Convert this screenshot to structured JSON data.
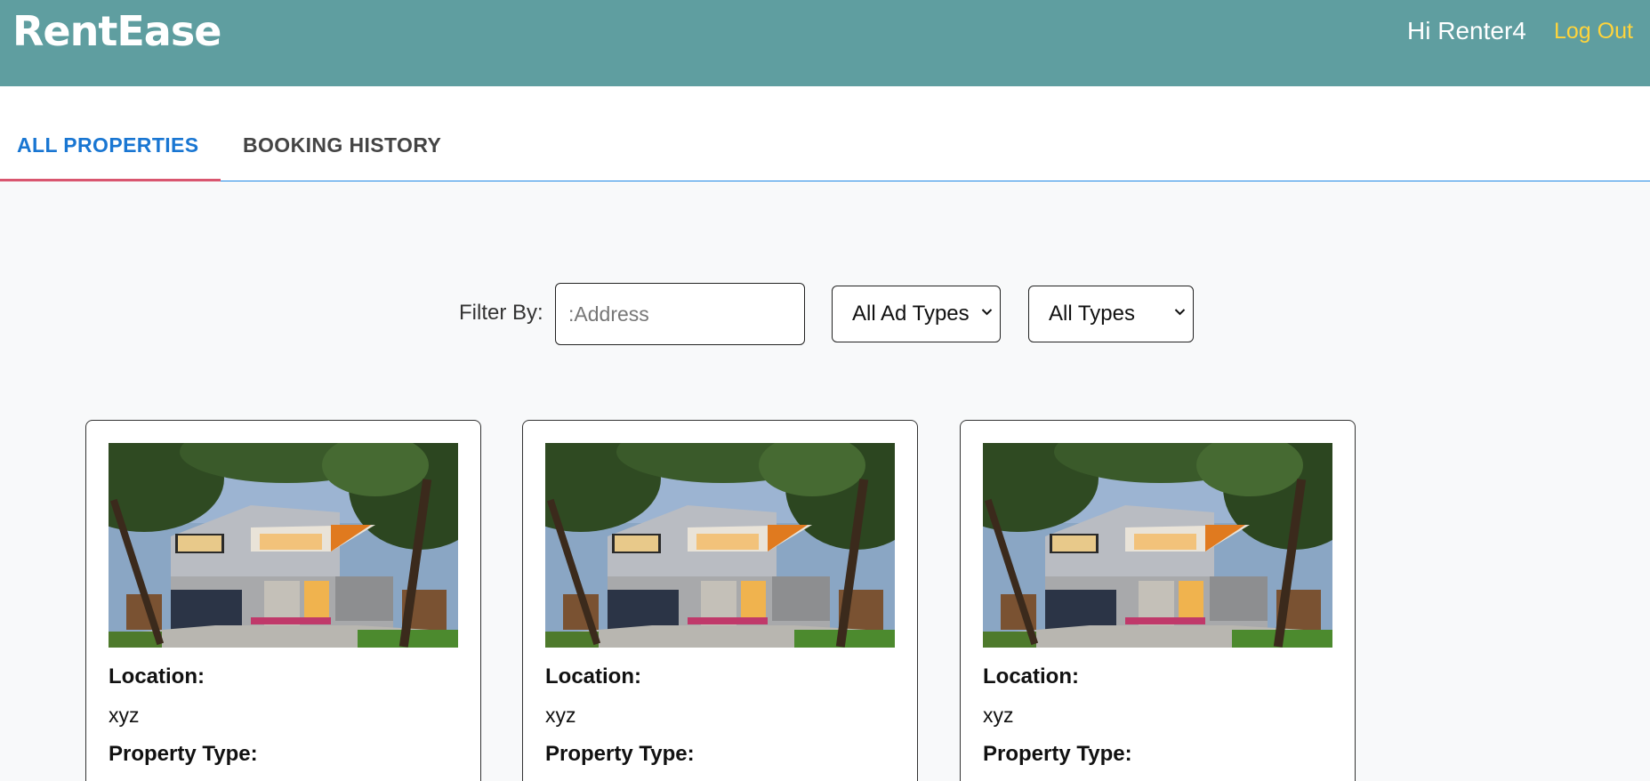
{
  "app": {
    "brand": "RentEase"
  },
  "header": {
    "greeting": "Hi Renter4",
    "logout_label": "Log Out"
  },
  "tabs": [
    {
      "label": "ALL PROPERTIES",
      "active": true
    },
    {
      "label": "BOOKING HISTORY",
      "active": false
    }
  ],
  "filter": {
    "label": "Filter By:",
    "address_placeholder": ":Address",
    "address_value": "",
    "ad_type_selected": "All Ad Types",
    "property_type_selected": "All Types"
  },
  "properties": [
    {
      "image_alt": "house-photo",
      "location_label": "Location:",
      "location": "xyz",
      "property_type_label": "Property Type:"
    },
    {
      "image_alt": "house-photo",
      "location_label": "Location:",
      "location": "xyz",
      "property_type_label": "Property Type:"
    },
    {
      "image_alt": "house-photo",
      "location_label": "Location:",
      "location": "xyz",
      "property_type_label": "Property Type:"
    }
  ],
  "colors": {
    "navbar": "#5f9ea0",
    "logout": "#ffd43b",
    "active_tab": "#1976d2",
    "tab_indicator": "#d9566f",
    "background": "#f8f9fa"
  }
}
